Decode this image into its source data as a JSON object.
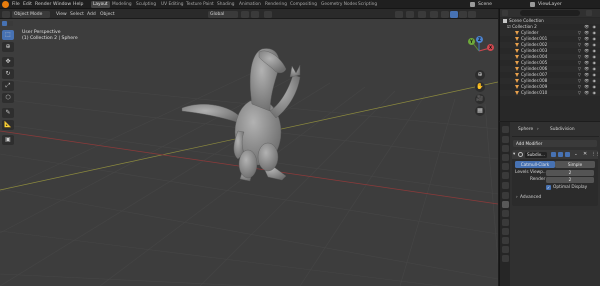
{
  "menu": [
    "File",
    "Edit",
    "Render",
    "Window",
    "Help"
  ],
  "workspaces": [
    "Layout",
    "Modeling",
    "Sculpting",
    "UV Editing",
    "Texture Paint",
    "Shading",
    "Animation",
    "Rendering",
    "Compositing",
    "Geometry Nodes",
    "Scripting"
  ],
  "active_workspace": "Layout",
  "scene": {
    "scene_label": "Scene",
    "viewlayer_label": "ViewLayer"
  },
  "viewport_header": {
    "mode": "Object Mode",
    "menus": [
      "View",
      "Select",
      "Add",
      "Object"
    ],
    "orientation": "Global",
    "options": "Options"
  },
  "viewport": {
    "view_name": "User Perspective",
    "context": "(1) Collection 2 | Sphere",
    "gizmo": {
      "x": "X",
      "y": "Y",
      "z": "Z"
    }
  },
  "outliner": {
    "title": "Scene Collection",
    "collection": "Collection 2",
    "items": [
      "Cylinder",
      "Cylinder.001",
      "Cylinder.002",
      "Cylinder.003",
      "Cylinder.004",
      "Cylinder.005",
      "Cylinder.006",
      "Cylinder.007",
      "Cylinder.008",
      "Cylinder.009",
      "Cylinder.010"
    ]
  },
  "properties": {
    "object": "Sphere",
    "modifier_path": "Subdivision",
    "add_modifier": "Add Modifier",
    "modifier_name": "Subdiv...",
    "methods": [
      "Catmull-Clark",
      "Simple"
    ],
    "active_method": "Catmull-Clark",
    "levels_viewport_label": "Levels Viewp...",
    "levels_viewport": "2",
    "render_label": "Render",
    "render": "2",
    "optimal_display": "Optimal Display",
    "advanced": "Advanced"
  },
  "colors": {
    "accent": "#4772b3",
    "orange": "#e8a04b",
    "grid_x": "#9b3a3a",
    "grid_y": "#6e8e2a"
  }
}
